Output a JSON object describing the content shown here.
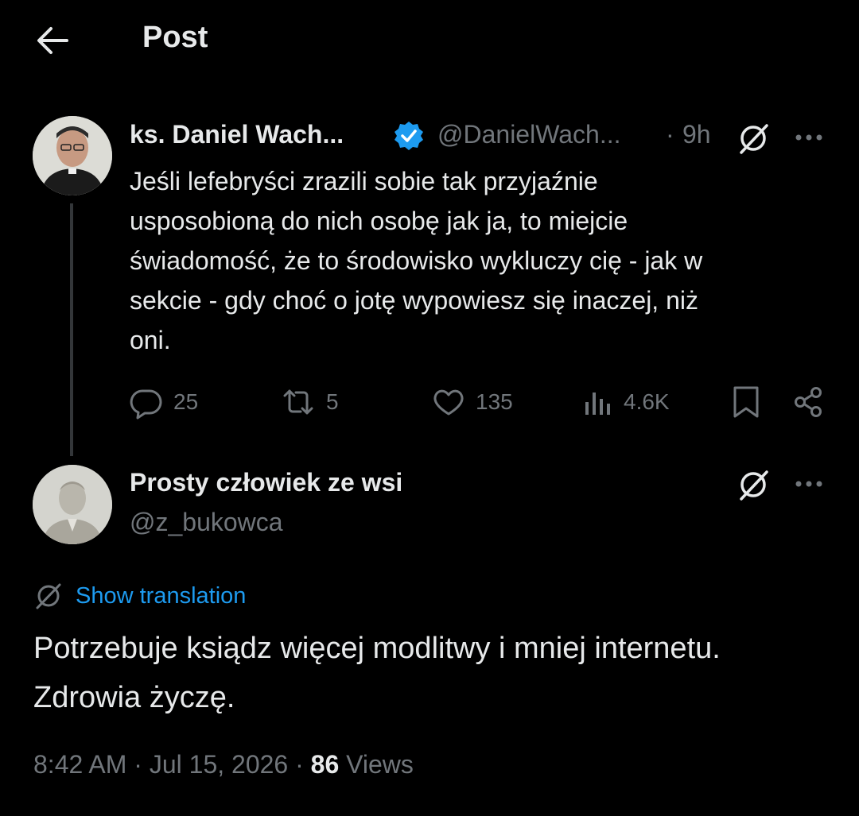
{
  "header": {
    "title": "Post",
    "back_icon": "arrow-left-icon"
  },
  "parent_tweet": {
    "author_name": "ks. Daniel Wach...",
    "verified_icon": "verified-badge-icon",
    "handle": "@DanielWach...",
    "separator": "·",
    "time": "9h",
    "text_lines": [
      "Jeśli lefebryści zrazili sobie tak przyjaźnie",
      "usposobioną do nich osobę jak ja, to miejcie",
      "świadomość, że to środowisko wykluczy cię - jak w",
      "sekcie - gdy choć o jotę wypowiesz się inaczej, niż",
      "oni."
    ],
    "actions": {
      "replies": "25",
      "reposts": "5",
      "likes": "135",
      "views": "4.6K"
    }
  },
  "main_tweet": {
    "author_name": "Prosty człowiek ze wsi",
    "handle": "@z_bukowca",
    "translation_link": "Show translation",
    "text_lines": [
      "Potrzebuje ksiądz więcej modlitwy i mniej internetu.",
      "Zdrowia życzę."
    ],
    "time": "8:42 AM",
    "date": "Jul 15, 2026",
    "separator": "·",
    "views_count": "86",
    "views_label": "Views"
  },
  "colors": {
    "background": "#000000",
    "text_primary": "#e7e9ea",
    "text_secondary": "#71767b",
    "accent": "#1d9bf0",
    "thread_line": "#333639"
  }
}
